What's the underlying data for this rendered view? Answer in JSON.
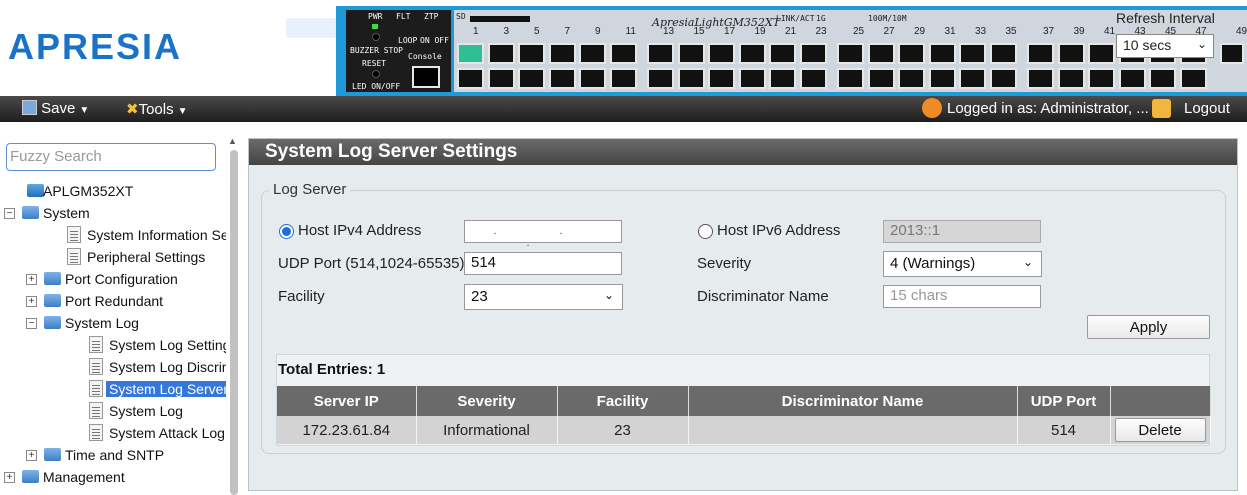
{
  "header": {
    "logo_text": "APRESIA",
    "device": {
      "model": "ApresiaLightGM352XT",
      "labels": {
        "pwr": "PWR",
        "flt": "FLT",
        "ztp": "ZTP",
        "sd": "SD",
        "loop": "LOOP",
        "on_off": "ON OFF",
        "buzzer_stop": "BUZZER STOP",
        "reset": "RESET",
        "led_onoff": "LED ON/OFF",
        "console": "Console",
        "link_act": "LINK/ACT",
        "speed_1g": "1G",
        "speed_100m": "100M/10M"
      },
      "port_numbers": [
        "1",
        "3",
        "5",
        "7",
        "9",
        "11",
        "13",
        "15",
        "17",
        "19",
        "21",
        "23",
        "25",
        "27",
        "29",
        "31",
        "33",
        "35",
        "37",
        "39",
        "41",
        "43",
        "45",
        "47",
        "49"
      ],
      "up_ports": [
        0
      ]
    },
    "refresh": {
      "label": "Refresh Interval",
      "value": "10 secs"
    }
  },
  "toolbar": {
    "save_label": "Save",
    "tools_label": "Tools",
    "logged_in": "Logged in as: Administrator, ...",
    "logout_label": "Logout"
  },
  "sidebar": {
    "search_placeholder": "Fuzzy Search",
    "tree": [
      {
        "label": "APLGM352XT",
        "level": 0,
        "kind": "device"
      },
      {
        "label": "System",
        "level": 0,
        "kind": "folder",
        "expanded": true
      },
      {
        "label": "System Information Settings",
        "level": 1,
        "kind": "page"
      },
      {
        "label": "Peripheral Settings",
        "level": 1,
        "kind": "page"
      },
      {
        "label": "Port Configuration",
        "level": 1,
        "kind": "folder",
        "expanded": false
      },
      {
        "label": "Port Redundant",
        "level": 1,
        "kind": "folder",
        "expanded": false
      },
      {
        "label": "System Log",
        "level": 1,
        "kind": "folder",
        "expanded": true
      },
      {
        "label": "System Log Settings",
        "level": 2,
        "kind": "page"
      },
      {
        "label": "System Log Discriminator",
        "level": 2,
        "kind": "page"
      },
      {
        "label": "System Log Server Settings",
        "level": 2,
        "kind": "page",
        "selected": true
      },
      {
        "label": "System Log",
        "level": 2,
        "kind": "page"
      },
      {
        "label": "System Attack Log",
        "level": 2,
        "kind": "page"
      },
      {
        "label": "Time and SNTP",
        "level": 1,
        "kind": "folder",
        "expanded": false
      },
      {
        "label": "Management",
        "level": 0,
        "kind": "folder",
        "expanded": false
      }
    ]
  },
  "main": {
    "title": "System Log Server Settings",
    "section_legend": "Log Server",
    "form": {
      "host_ipv4_label": "Host IPv4 Address",
      "host_ipv4_selected": true,
      "host_ipv4_value": ". . .",
      "host_ipv6_label": "Host IPv6 Address",
      "host_ipv6_value": "2013::1",
      "udp_port_label": "UDP Port (514,1024-65535)",
      "udp_port_value": "514",
      "severity_label": "Severity",
      "severity_value": "4 (Warnings)",
      "facility_label": "Facility",
      "facility_value": "23",
      "discriminator_label": "Discriminator Name",
      "discriminator_placeholder": "15 chars",
      "apply_label": "Apply"
    },
    "table": {
      "total_label": "Total Entries: 1",
      "columns": [
        "Server IP",
        "Severity",
        "Facility",
        "Discriminator Name",
        "UDP Port",
        ""
      ],
      "rows": [
        {
          "server_ip": "172.23.61.84",
          "severity": "Informational",
          "facility": "23",
          "discriminator": "",
          "udp_port": "514",
          "action": "Delete"
        }
      ]
    }
  },
  "colors": {
    "brand": "#1a73c8",
    "device_blue": "#1f9ad6",
    "selection": "#3578d9",
    "header_bar": "#444444",
    "panel_bg": "#e6ebee"
  }
}
